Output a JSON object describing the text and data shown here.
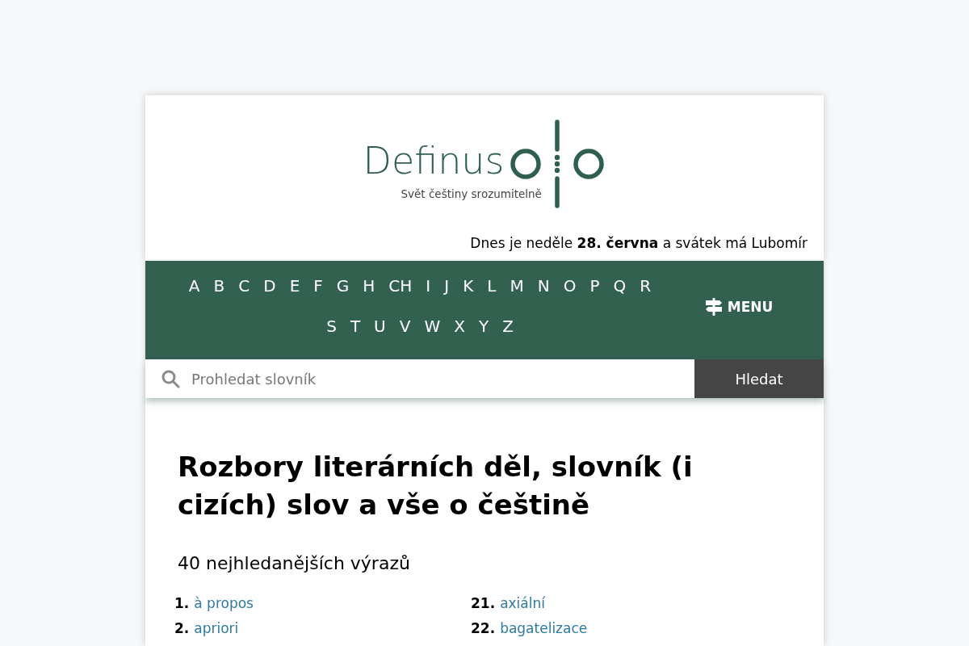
{
  "header": {
    "logo": {
      "name": "Definus",
      "tagline": "Svět češtiny srozumitelně"
    },
    "date_line": "Dnes je neděle **28. června** a svátek má Lubomír"
  },
  "nav": {
    "letters": [
      "A",
      "B",
      "C",
      "D",
      "E",
      "F",
      "G",
      "H",
      "CH",
      "I",
      "J",
      "K",
      "L",
      "M",
      "N",
      "O",
      "P",
      "Q",
      "R",
      "S",
      "T",
      "U",
      "V",
      "W",
      "X",
      "Y",
      "Z"
    ],
    "menu_button": "MENU"
  },
  "search": {
    "placeholder": "Prohledat slovník",
    "button": "Hledat"
  },
  "main": {
    "title": "Rozbory literárních děl, slovník (i cizích) slov a vše o češtině",
    "top_terms": {
      "heading": "40 nejhledanějších výrazů",
      "columns": [
        [
          {
            "rank": "1.",
            "term": "à propos"
          },
          {
            "rank": "2.",
            "term": "apriori"
          }
        ],
        [
          {
            "rank": "21.",
            "term": "axiální"
          },
          {
            "rank": "22.",
            "term": "bagatelizace"
          }
        ]
      ]
    }
  }
}
